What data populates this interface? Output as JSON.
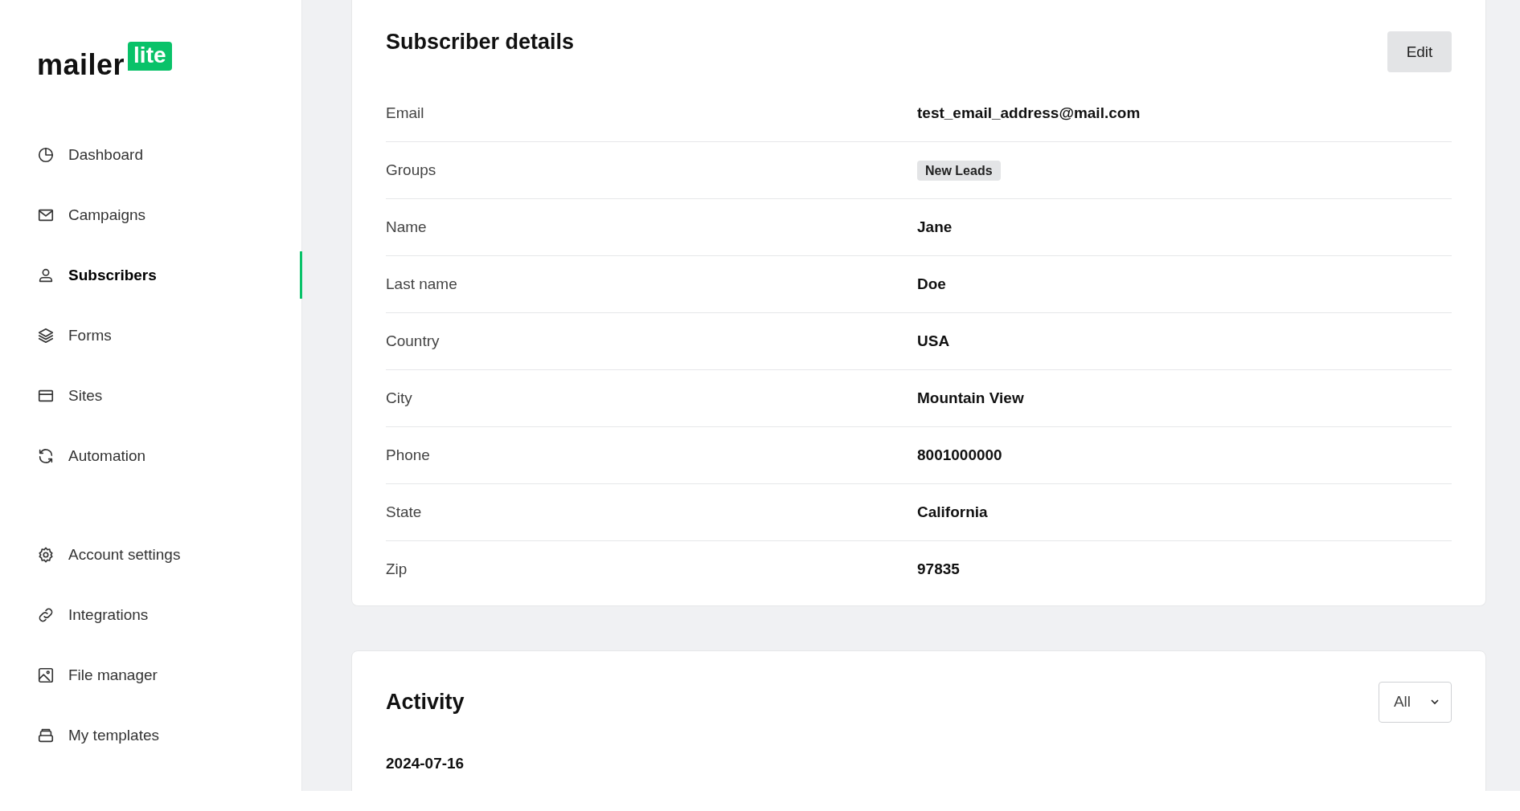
{
  "logo": {
    "word": "mailer",
    "badge": "lite"
  },
  "sidebar": {
    "items": [
      {
        "label": "Dashboard",
        "kind": "pie",
        "selected": false
      },
      {
        "label": "Campaigns",
        "kind": "mail",
        "selected": false
      },
      {
        "label": "Subscribers",
        "kind": "person",
        "selected": true
      },
      {
        "label": "Forms",
        "kind": "layers",
        "selected": false
      },
      {
        "label": "Sites",
        "kind": "browser",
        "selected": false
      },
      {
        "label": "Automation",
        "kind": "refresh",
        "selected": false
      }
    ],
    "bottom_items": [
      {
        "label": "Account settings",
        "kind": "gear",
        "selected": false
      },
      {
        "label": "Integrations",
        "kind": "link",
        "selected": false
      },
      {
        "label": "File manager",
        "kind": "image",
        "selected": false
      },
      {
        "label": "My templates",
        "kind": "stack",
        "selected": false
      }
    ]
  },
  "subscriber_details": {
    "title": "Subscriber details",
    "edit_button": "Edit",
    "fields": [
      {
        "label": "Email",
        "kind": "text",
        "value": "test_email_address@mail.com"
      },
      {
        "label": "Groups",
        "kind": "tags",
        "tags": [
          "New Leads"
        ]
      },
      {
        "label": "Name",
        "kind": "text",
        "value": "Jane"
      },
      {
        "label": "Last name",
        "kind": "text",
        "value": "Doe"
      },
      {
        "label": "Country",
        "kind": "text",
        "value": "USA"
      },
      {
        "label": "City",
        "kind": "text",
        "value": "Mountain View"
      },
      {
        "label": "Phone",
        "kind": "text",
        "value": "8001000000"
      },
      {
        "label": "State",
        "kind": "text",
        "value": "California"
      },
      {
        "label": "Zip",
        "kind": "text",
        "value": "97835"
      }
    ]
  },
  "activity": {
    "title": "Activity",
    "filter": "All",
    "date": "2024-07-16"
  }
}
